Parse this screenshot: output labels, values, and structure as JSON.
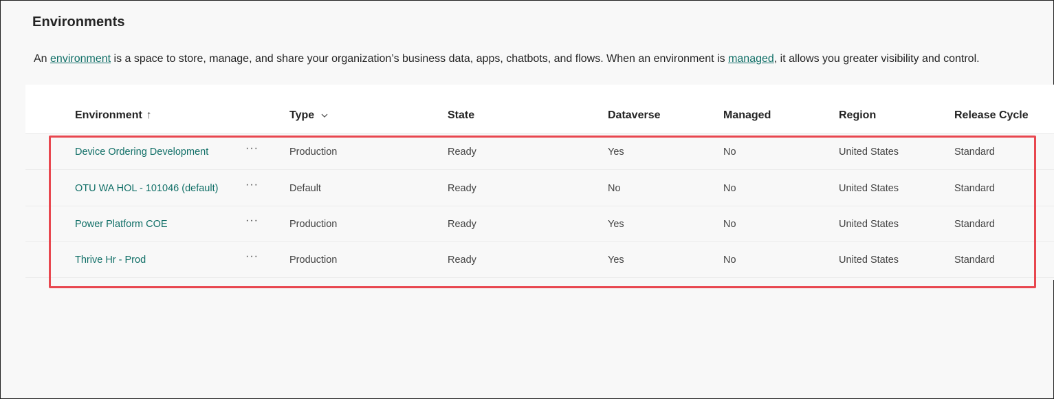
{
  "page": {
    "title": "Environments"
  },
  "description": {
    "prefix": "An ",
    "link1": "environment",
    "middle": " is a space to store, manage, and share your organization’s business data, apps, chatbots, and flows. When an environment is ",
    "link2": "managed",
    "suffix": ", it allows you greater visibility and control."
  },
  "table": {
    "columns": {
      "environment": "Environment",
      "environment_sort_arrow": "↑",
      "type": "Type",
      "state": "State",
      "dataverse": "Dataverse",
      "managed": "Managed",
      "region": "Region",
      "release_cycle": "Release Cycle"
    },
    "more_label": "···",
    "rows": [
      {
        "name": "Device Ordering Development",
        "type": "Production",
        "state": "Ready",
        "dataverse": "Yes",
        "managed": "No",
        "region": "United States",
        "release_cycle": "Standard"
      },
      {
        "name": "OTU WA HOL - 101046 (default)",
        "type": "Default",
        "state": "Ready",
        "dataverse": "No",
        "managed": "No",
        "region": "United States",
        "release_cycle": "Standard"
      },
      {
        "name": "Power Platform COE",
        "type": "Production",
        "state": "Ready",
        "dataverse": "Yes",
        "managed": "No",
        "region": "United States",
        "release_cycle": "Standard"
      },
      {
        "name": "Thrive Hr - Prod",
        "type": "Production",
        "state": "Ready",
        "dataverse": "Yes",
        "managed": "No",
        "region": "United States",
        "release_cycle": "Standard"
      }
    ]
  },
  "colors": {
    "link": "#0f6e66",
    "highlight_border": "#e8474f",
    "background": "#f8f8f8"
  }
}
